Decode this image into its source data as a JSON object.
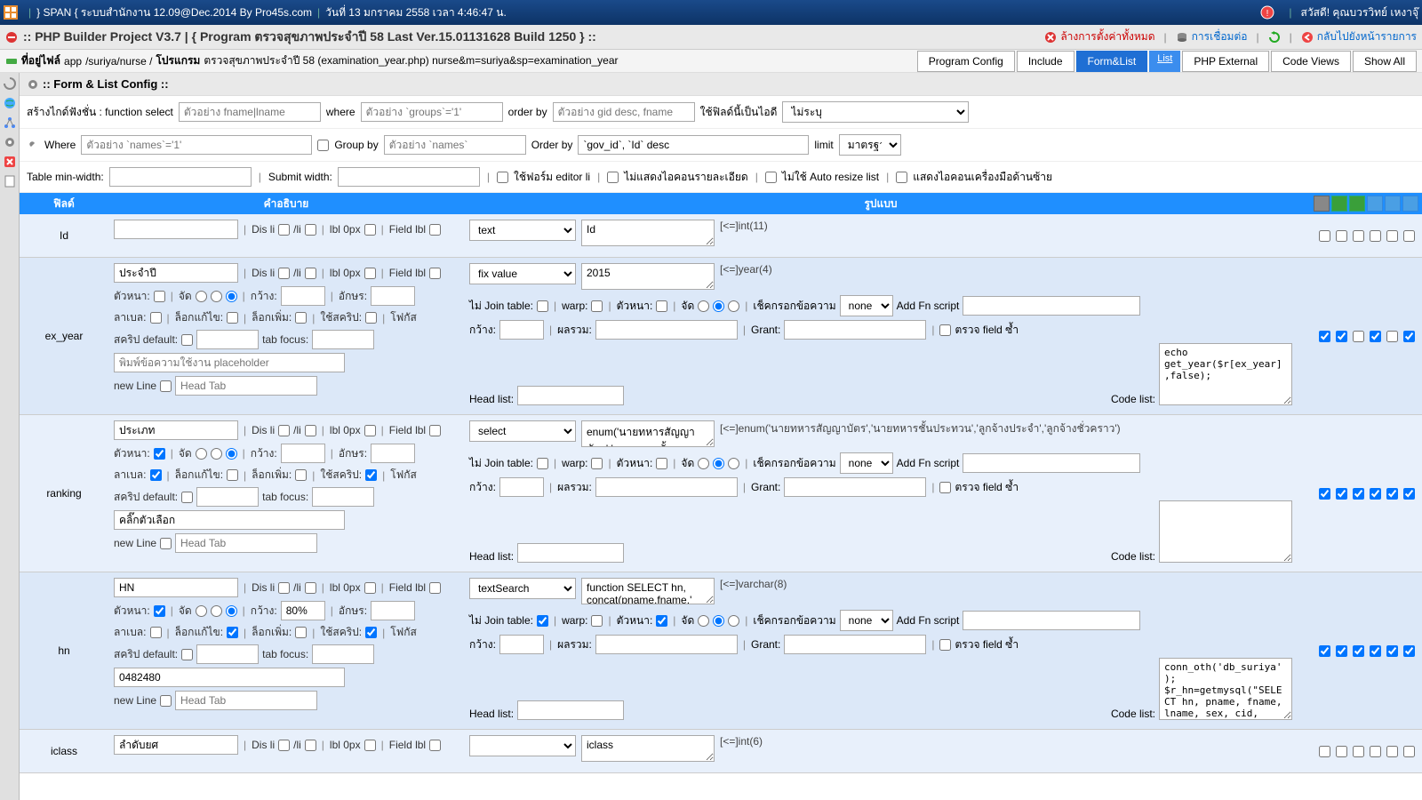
{
  "topbar": {
    "title": "} SPAN { ระบบสำนักงาน 12.09@Dec.2014 By Pro45s.com",
    "date": "วันที่ 13 มกราคม 2558 เวลา 4:46:47 น.",
    "greeting": "สวัสดี! คุณบวรวิทย์ เหงาจุ๊"
  },
  "titlebar": {
    "title": ":: PHP Builder Project V3.7 | { Program ตรวจสุขภาพประจำปี 58 Last Ver.15.01131628 Build 1250 } ::",
    "clear_config": "ล้างการตั้งค่าทั้งหมด",
    "connection": "การเชื่อมต่อ",
    "back": "กลับไปยังหน้ารายการ"
  },
  "pathbar": {
    "label": "ที่อยู่ไฟล์",
    "app": "app",
    "path1": "/suriya/nurse /",
    "program": "โปรแกรม",
    "path2": "ตรวจสุขภาพประจำปี 58 (examination_year.php) nurse&m=suriya&sp=examination_year",
    "tabs": [
      "Program Config",
      "Include",
      "Form&List",
      "List",
      "PHP External",
      "Code Views",
      "Show All"
    ],
    "active_tab": 2,
    "sub_tab": 3
  },
  "section_title": ":: Form & List Config ::",
  "config1": {
    "label1": "สร้างไกด์ฟังชั่น : function select",
    "ph1": "ตัวอย่าง fname|lname",
    "label2": "where",
    "ph2": "ตัวอย่าง `groups`='1'",
    "label3": "order by",
    "ph3": "ตัวอย่าง gid desc, fname",
    "label4": "ใช้ฟิลด์นี้เป็นไอดี",
    "select1": "ไม่ระบุ"
  },
  "config2": {
    "label1": "Where",
    "ph1": "ตัวอย่าง `names`='1'",
    "label2": "Group by",
    "ph2": "ตัวอย่าง `names`",
    "label3": "Order by",
    "val3": "`gov_id`, `Id` desc",
    "label4": "limit",
    "select4": "มาตรฐาน"
  },
  "config3": {
    "label1": "Table min-width:",
    "label2": "Submit width:",
    "cb1": "ใช้ฟอร์ม editor li",
    "cb2": "ไม่แสดงไอคอนรายละเอียด",
    "cb3": "ไม่ใช้ Auto resize list",
    "cb4": "แสดงไอคอนเครื่องมือด้านซ้าย"
  },
  "headers": {
    "field": "ฟิลด์",
    "desc": "คำอธิบาย",
    "form": "รูปแบบ"
  },
  "common": {
    "dis_li": "Dis li",
    "li": "/li",
    "lbl_0px": "lbl 0px",
    "field_lbl": "Field lbl",
    "bold": "ตัวหนา:",
    "align": "จัด",
    "width": "กว้าง:",
    "chars": "อักษร:",
    "label": "ลาเบล:",
    "lock_edit": "ล็อกแก้ไข:",
    "lock_add": "ล็อกเพิ่ม:",
    "use_script": "ใช้สคริป:",
    "focus": "โฟกัส",
    "script_default": "สคริป default:",
    "tab_focus": "tab focus:",
    "placeholder_ph": "พิมพ์ข้อความใช้งาน placeholder",
    "new_line": "new Line",
    "head_tab_ph": "Head Tab",
    "no_join": "ไม่ Join table:",
    "warp": "warp:",
    "bold2": "ตัวหนา:",
    "align2": "จัด",
    "check_input": "เช็คกรอกข้อความ",
    "none": "none",
    "add_fn": "Add Fn script",
    "width2": "กว้าง:",
    "sum": "ผลรวม:",
    "grant": "Grant:",
    "check_dup": "ตรวจ field ซ้ำ",
    "head_list": "Head list:",
    "code_list": "Code list:"
  },
  "rows": [
    {
      "field": "Id",
      "desc_val": "",
      "type_select": "text",
      "field_textarea": "Id",
      "type_info": "[<=]int(11)",
      "code_val": "",
      "checks": [
        false,
        false,
        false,
        false,
        false,
        false
      ]
    },
    {
      "field": "ex_year",
      "desc_val": "ประจำปี",
      "type_select": "fix value",
      "field_textarea": "2015",
      "type_info": "[<=]year(4)",
      "code_val": "echo get_year($r[ex_year],false);",
      "placeholder_val": "",
      "checks": [
        true,
        true,
        false,
        true,
        false,
        true
      ]
    },
    {
      "field": "ranking",
      "desc_val": "ประเภท",
      "type_select": "select",
      "field_textarea": "enum('นายทหารสัญญาบัตร','นายทหารชั้น",
      "type_info": "[<=]enum('นายทหารสัญญาบัตร','นายทหารชั้นประทวน','ลูกจ้างประจำ','ลูกจ้างชั่วคราว')",
      "code_val": "",
      "placeholder_val": "คลิ๊กตัวเลือก",
      "bold_checked": true,
      "label_checked": true,
      "script_checked": true,
      "checks": [
        true,
        true,
        true,
        true,
        true,
        true
      ]
    },
    {
      "field": "hn",
      "desc_val": "HN",
      "type_select": "textSearch",
      "field_textarea": "function SELECT hn, concat(pname,fname,'",
      "type_info": "[<=]varchar(8)",
      "code_val": "conn_oth('db_suriya'); $r_hn=getmysql(\"SELECT hn, pname, fname, lname, sex, cid, birthday",
      "placeholder_val": "0482480",
      "width_val": "80%",
      "bold_checked": true,
      "lock_edit_checked": true,
      "script_checked": true,
      "join_checked": true,
      "bold2_checked": true,
      "checks": [
        true,
        true,
        true,
        true,
        true,
        true
      ]
    },
    {
      "field": "iclass",
      "desc_val": "ลำดับยศ",
      "type_select": "",
      "field_textarea": "iclass",
      "type_info": "[<=]int(6)",
      "checks": [
        false,
        false,
        false,
        false,
        false,
        false
      ]
    }
  ]
}
